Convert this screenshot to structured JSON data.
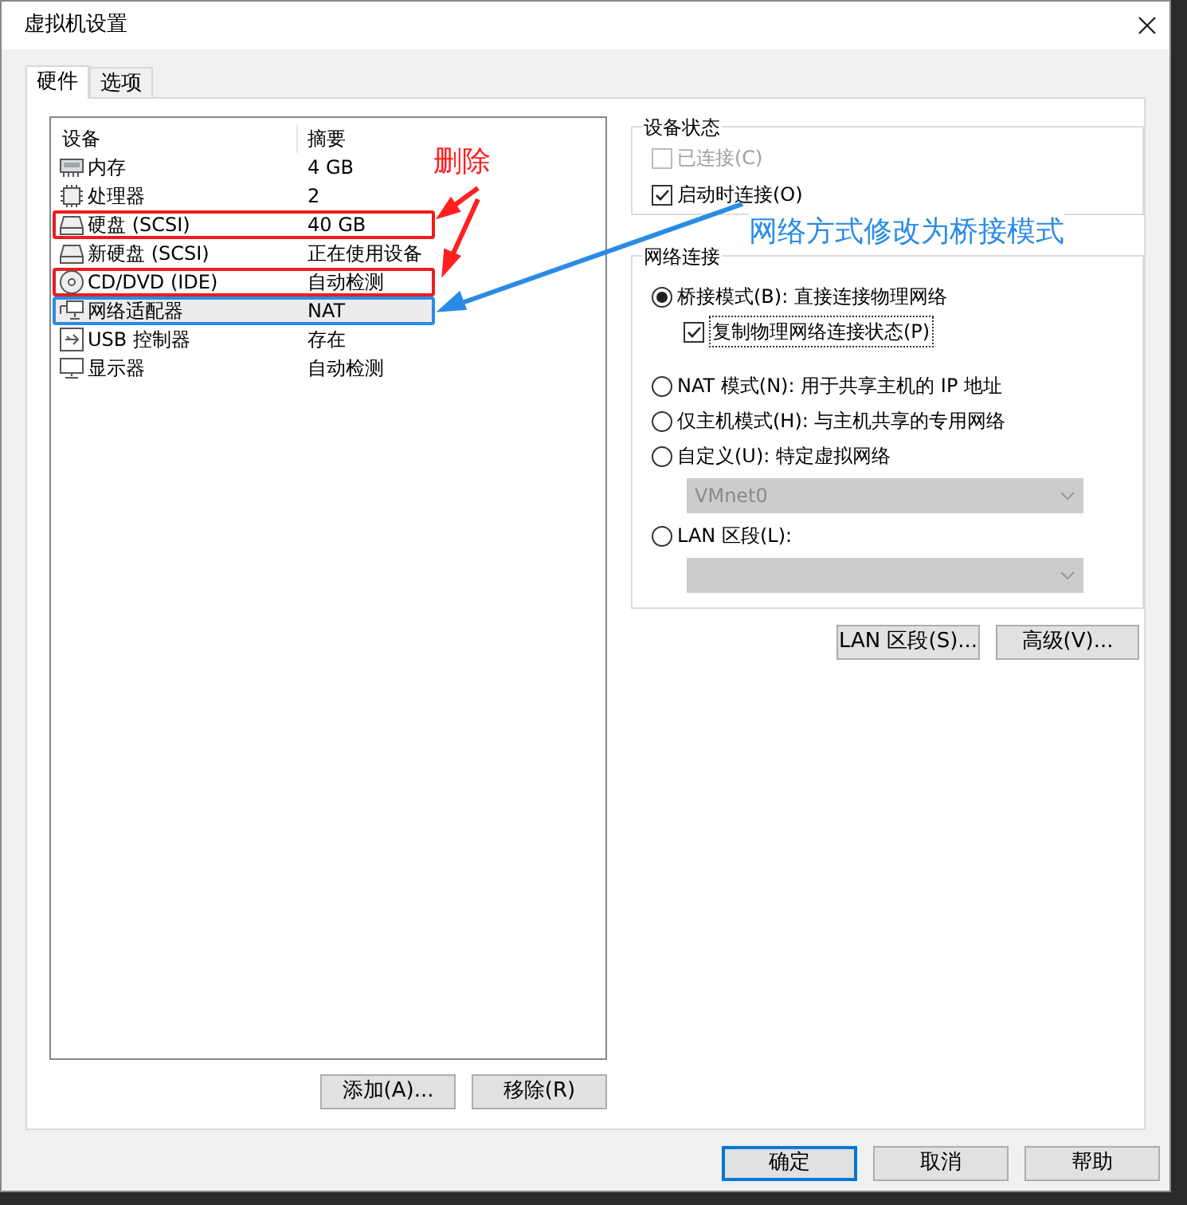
{
  "window": {
    "title": "虚拟机设置"
  },
  "tabs": [
    {
      "label": "硬件",
      "selected": true
    },
    {
      "label": "选项",
      "selected": false
    }
  ],
  "device_list": {
    "columns": [
      "设备",
      "摘要"
    ],
    "rows": [
      {
        "kind": "memory",
        "device": "内存",
        "summary": "4 GB",
        "selected": false
      },
      {
        "kind": "processor",
        "device": "处理器",
        "summary": "2",
        "selected": false
      },
      {
        "kind": "disk",
        "device": "硬盘 (SCSI)",
        "summary": "40 GB",
        "selected": false,
        "color": "#ee1c1c"
      },
      {
        "kind": "disk",
        "device": "新硬盘 (SCSI)",
        "summary": "正在使用设备",
        "selected": false
      },
      {
        "kind": "cd",
        "device": "CD/DVD (IDE)",
        "summary": "自动检测",
        "selected": false,
        "color": "#ee1c1c"
      },
      {
        "kind": "network",
        "device": "网络适配器",
        "summary": "NAT",
        "selected": true,
        "color": "#2a8be6"
      },
      {
        "kind": "usb",
        "device": "USB 控制器",
        "summary": "存在",
        "selected": false
      },
      {
        "kind": "display",
        "device": "显示器",
        "summary": "自动检测",
        "selected": false
      }
    ],
    "buttons": [
      "添加(A)...",
      "移除(R)"
    ]
  },
  "device_status": {
    "title": "设备状态",
    "options": [
      {
        "label": "已连接(C)",
        "checked": false,
        "disabled": true
      },
      {
        "label": "启动时连接(O)",
        "checked": true,
        "disabled": false
      }
    ]
  },
  "network_connection": {
    "title": "网络连接",
    "options": [
      {
        "kind": "radio",
        "label": "桥接模式(B): 直接连接物理网络",
        "selected": true
      },
      {
        "kind": "checkbox",
        "label": "复制物理网络连接状态(P)",
        "checked": true
      },
      {
        "kind": "radio",
        "label": "NAT 模式(N): 用于共享主机的 IP 地址",
        "selected": false
      },
      {
        "kind": "radio",
        "label": "仅主机模式(H): 与主机共享的专用网络",
        "selected": false
      },
      {
        "kind": "radio",
        "label": "自定义(U): 特定虚拟网络",
        "selected": false
      },
      {
        "kind": "dropdown",
        "value": "VMnet0",
        "disabled": true
      },
      {
        "kind": "radio",
        "label": "LAN 区段(L):",
        "selected": false
      },
      {
        "kind": "dropdown",
        "disabled": true
      }
    ]
  },
  "side_buttons": [
    "LAN 区段(S)...",
    "高级(V)..."
  ],
  "dialog_buttons": [
    {
      "label": "确定",
      "focused": true
    },
    {
      "label": "取消",
      "focused": false
    },
    {
      "label": "帮助",
      "focused": false
    }
  ],
  "annotations": [
    {
      "text": "删除",
      "color": "#ff2020"
    },
    {
      "text": "网络方式修改为桥接模式",
      "color": "#2a8be6"
    }
  ]
}
